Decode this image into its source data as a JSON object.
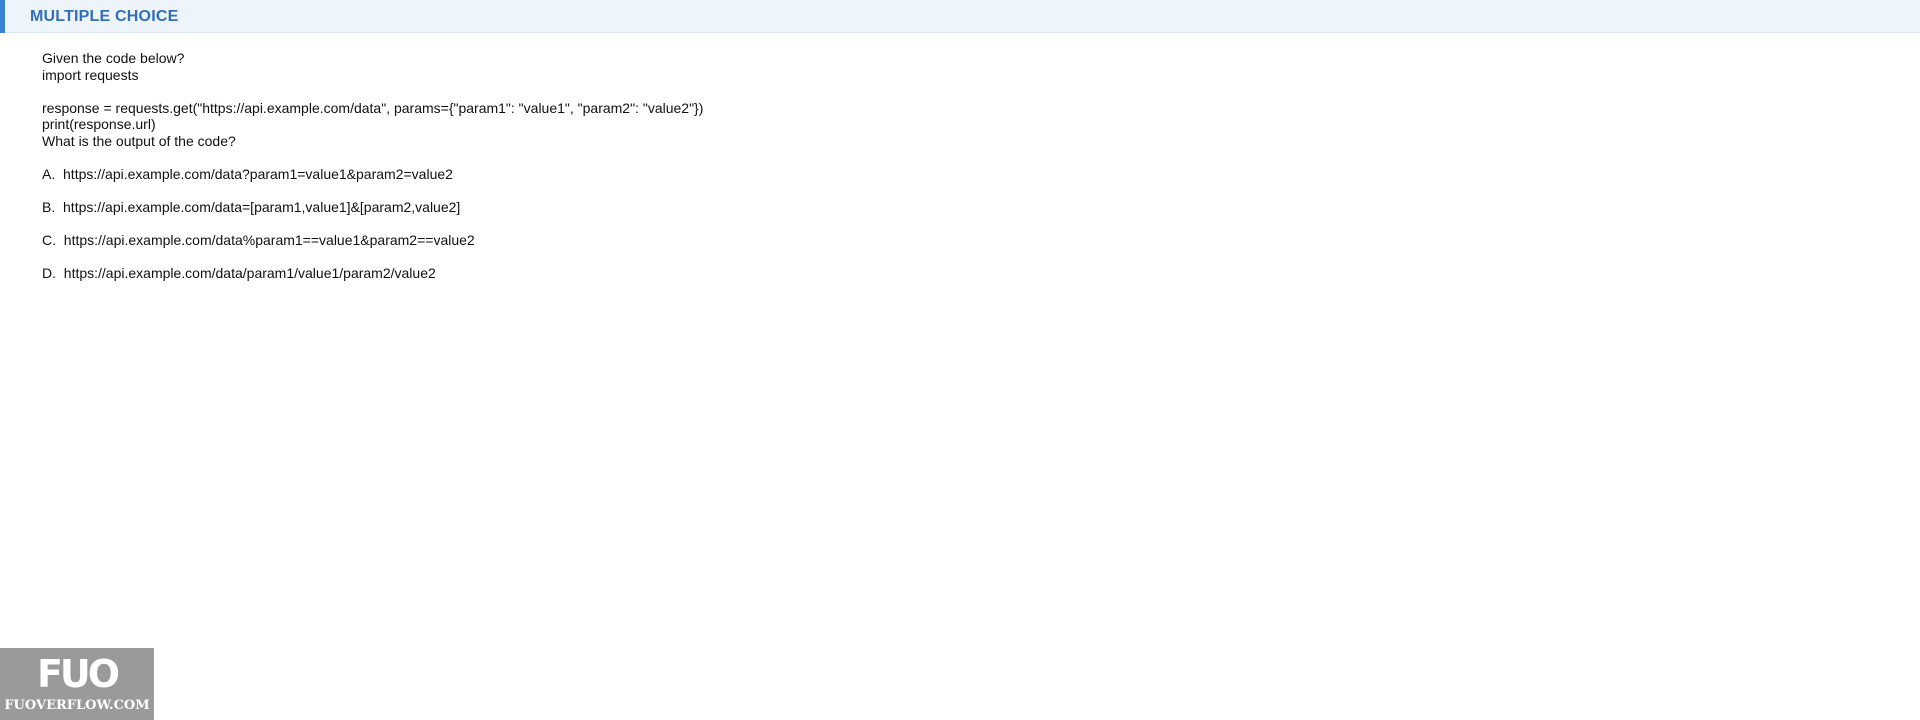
{
  "header": {
    "title": "MULTIPLE CHOICE",
    "accent_color": "#3b82d6",
    "title_color": "#2f6fbd",
    "background_color": "#eef4fc"
  },
  "question": {
    "lines": [
      "Given the code below?",
      "import requests",
      "",
      "response = requests.get(\"https://api.example.com/data\", params={\"param1\": \"value1\", \"param2\": \"value2\"})",
      "print(response.url)",
      "What is the output of the code?"
    ]
  },
  "options": [
    {
      "letter": "A.",
      "text": "https://api.example.com/data?param1=value1&param2=value2"
    },
    {
      "letter": "B.",
      "text": "https://api.example.com/data=[param1,value1]&[param2,value2]"
    },
    {
      "letter": "C.",
      "text": "https://api.example.com/data%param1==value1&param2==value2"
    },
    {
      "letter": "D.",
      "text": "https://api.example.com/data/param1/value1/param2/value2"
    }
  ],
  "watermark": {
    "logo": "FUO",
    "site": "FUOVERFLOW.COM"
  }
}
